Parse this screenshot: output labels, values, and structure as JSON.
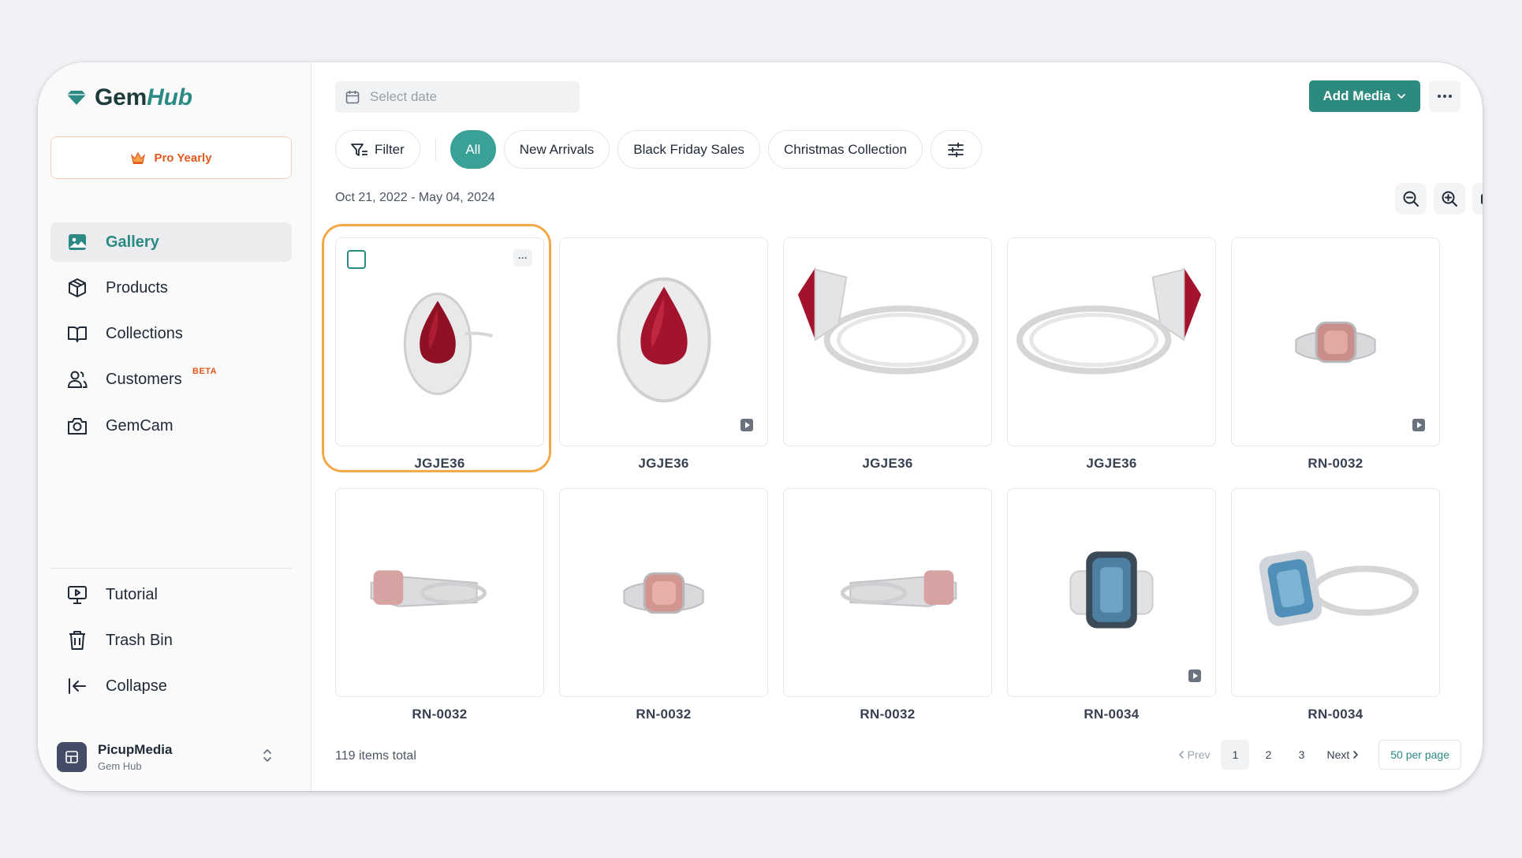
{
  "brand": {
    "name_a": "Gem",
    "name_b": "Hub",
    "accent": "#2b8a83"
  },
  "plan": {
    "label": "Pro Yearly",
    "icon": "crown-icon"
  },
  "sidebar": {
    "items": [
      {
        "label": "Gallery",
        "icon": "image-icon",
        "active": true
      },
      {
        "label": "Products",
        "icon": "box-icon"
      },
      {
        "label": "Collections",
        "icon": "book-icon"
      },
      {
        "label": "Customers",
        "icon": "users-icon",
        "badge": "BETA"
      },
      {
        "label": "GemCam",
        "icon": "camera-icon"
      }
    ],
    "bottom_items": [
      {
        "label": "Tutorial",
        "icon": "presentation-icon"
      },
      {
        "label": "Trash Bin",
        "icon": "trash-icon"
      },
      {
        "label": "Collapse",
        "icon": "collapse-icon"
      }
    ],
    "account": {
      "name": "PicupMedia",
      "sub": "Gem Hub"
    }
  },
  "toolbar": {
    "date_placeholder": "Select date",
    "add_media": "Add Media"
  },
  "filters": {
    "filter_label": "Filter",
    "chips": [
      "All",
      "New Arrivals",
      "Black Friday Sales",
      "Christmas Collection"
    ],
    "active": "All"
  },
  "date_range": "Oct 21, 2022 - May 04, 2024",
  "gallery": {
    "rows": [
      [
        {
          "label": "JGJE36",
          "selected": true
        },
        {
          "label": "JGJE36",
          "video": true
        },
        {
          "label": "JGJE36"
        },
        {
          "label": "JGJE36"
        },
        {
          "label": "RN-0032",
          "video": true
        }
      ],
      [
        {
          "label": "RN-0032"
        },
        {
          "label": "RN-0032"
        },
        {
          "label": "RN-0032"
        },
        {
          "label": "RN-0034",
          "video": true
        },
        {
          "label": "RN-0034"
        }
      ]
    ]
  },
  "footer": {
    "total": "119 items total",
    "prev": "Prev",
    "pages": [
      "1",
      "2",
      "3"
    ],
    "current_page": "1",
    "next": "Next",
    "per_page": "50 per page"
  }
}
